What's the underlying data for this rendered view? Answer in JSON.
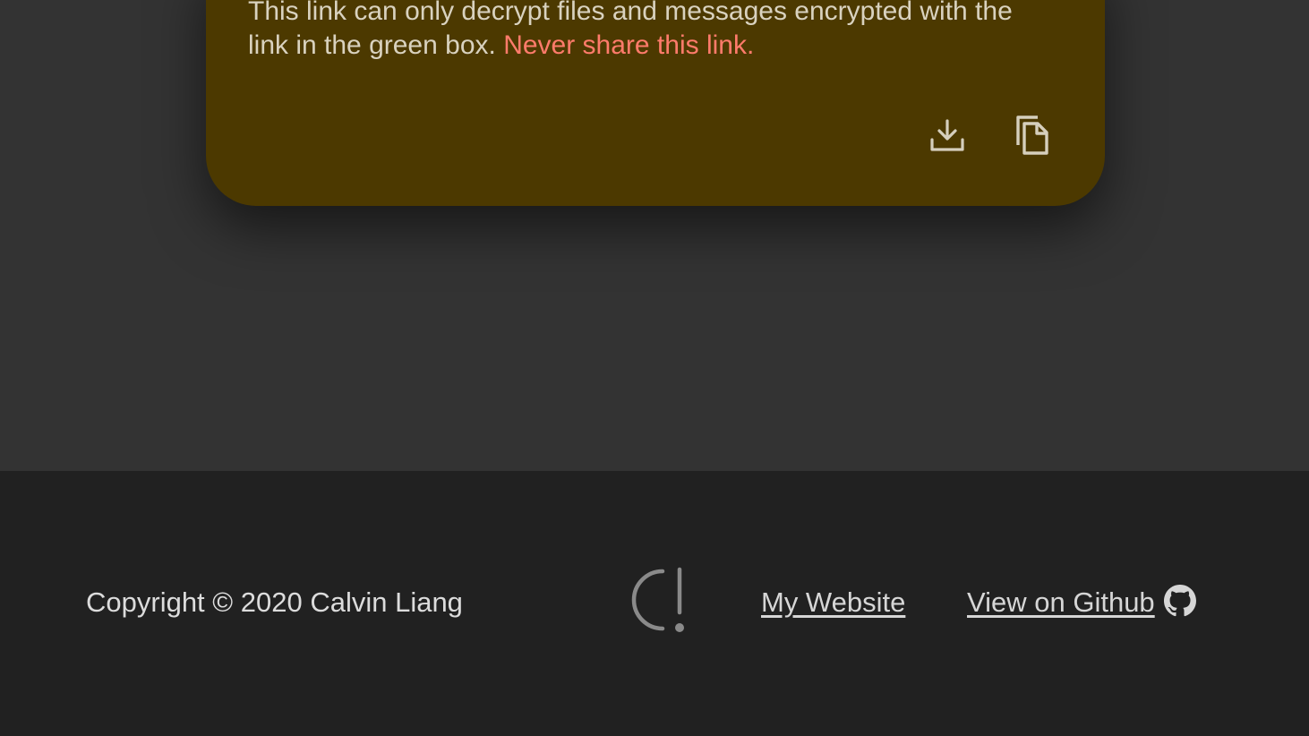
{
  "key_card": {
    "text_part1": "This link can only decrypt files and messages encrypted with the link in the green box.",
    "warning": "Never share this link.",
    "background_color": "#4c3900",
    "warning_color": "#ff7b6b",
    "icons": [
      "download-icon",
      "copy-icon"
    ]
  },
  "footer": {
    "copyright": "Copyright © 2020 Calvin Liang",
    "logo_icon": "logo-icon",
    "links": {
      "website": "My Website",
      "github": "View on Github"
    },
    "github_icon": "github-icon"
  }
}
